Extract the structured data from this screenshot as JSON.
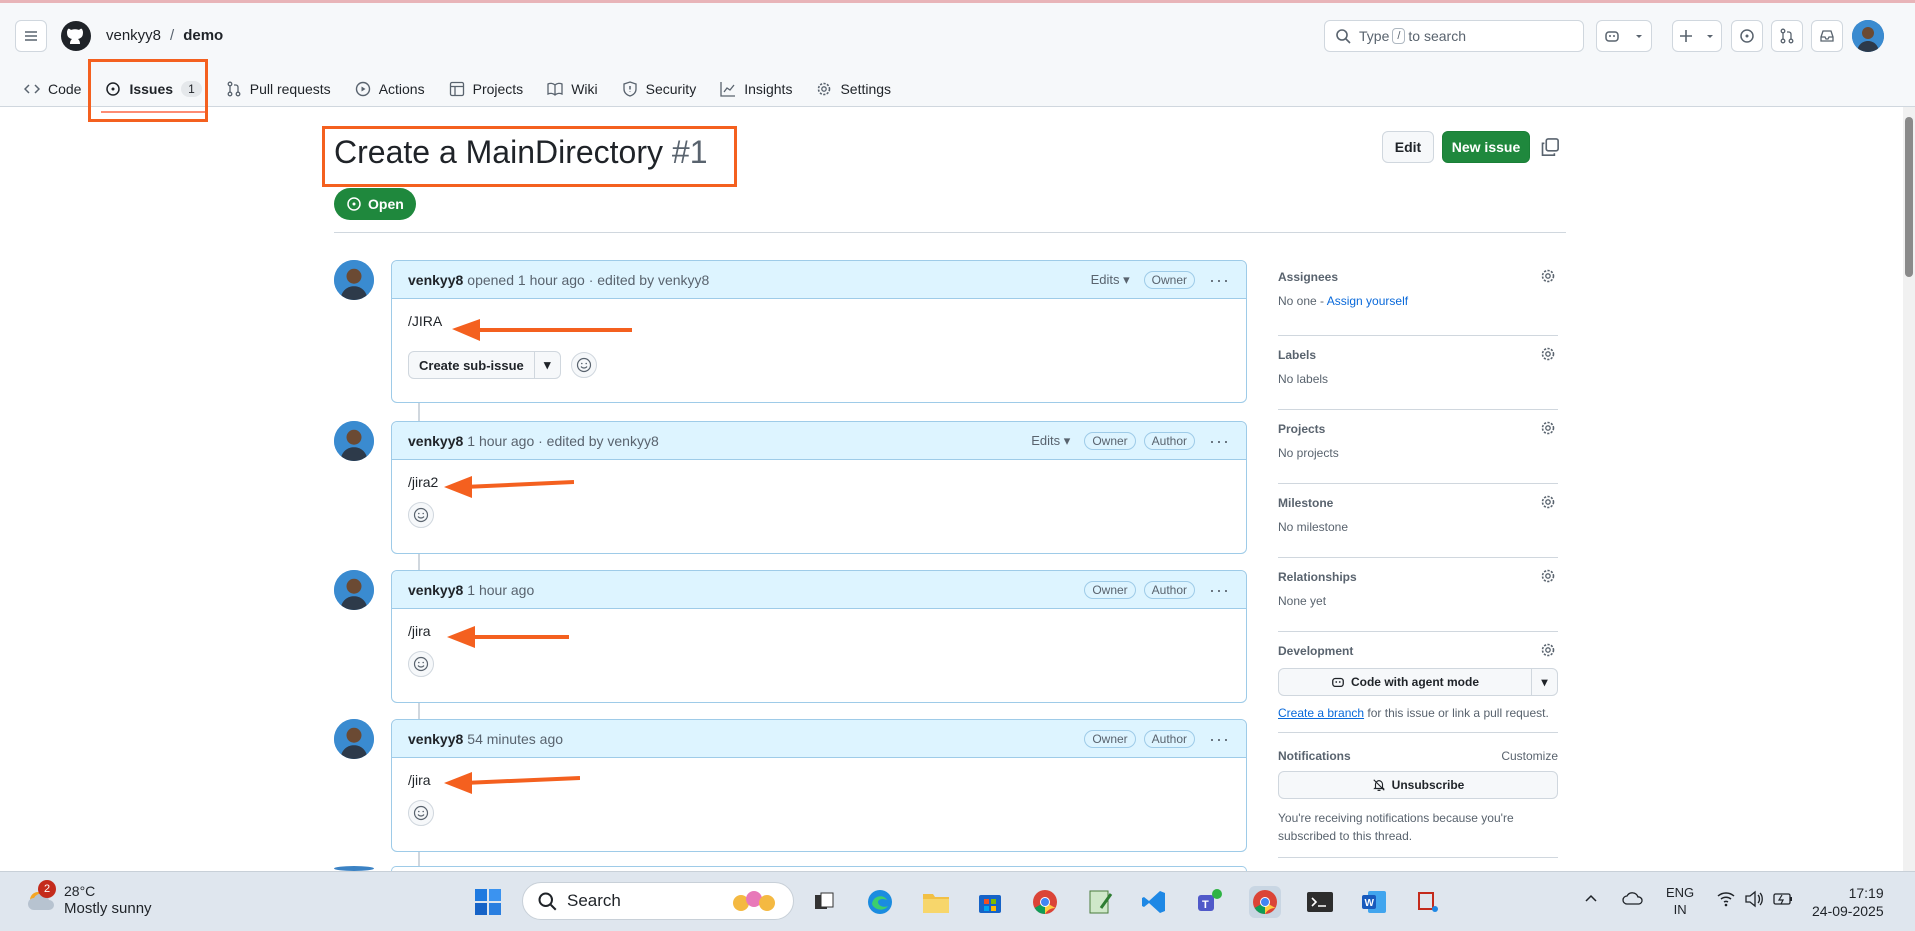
{
  "header": {
    "owner": "venkyy8",
    "separator": "/",
    "repo": "demo",
    "search_placeholder": "Type",
    "search_slash": "/",
    "search_suffix": "to search"
  },
  "tabs": [
    {
      "label": "Code",
      "icon": "code-icon"
    },
    {
      "label": "Issues",
      "icon": "issue-opened-icon",
      "count": "1",
      "active": true
    },
    {
      "label": "Pull requests",
      "icon": "git-pull-request-icon"
    },
    {
      "label": "Actions",
      "icon": "play-icon"
    },
    {
      "label": "Projects",
      "icon": "table-icon"
    },
    {
      "label": "Wiki",
      "icon": "book-icon"
    },
    {
      "label": "Security",
      "icon": "shield-icon"
    },
    {
      "label": "Insights",
      "icon": "graph-icon"
    },
    {
      "label": "Settings",
      "icon": "gear-icon"
    }
  ],
  "issue": {
    "title": "Create a MainDirectory",
    "number": "#1",
    "state": "Open",
    "edit_label": "Edit",
    "new_issue_label": "New issue"
  },
  "comments": [
    {
      "author": "venkyy8",
      "meta": "opened 1 hour ago · edited by venkyy8",
      "edits": "Edits",
      "roles": [
        "Owner"
      ],
      "body": "/JIRA",
      "sub_issue_label": "Create sub-issue"
    },
    {
      "author": "venkyy8",
      "meta": "1 hour ago · edited by venkyy8",
      "edits": "Edits",
      "roles": [
        "Owner",
        "Author"
      ],
      "body": "/jira2"
    },
    {
      "author": "venkyy8",
      "meta": "1 hour ago",
      "roles": [
        "Owner",
        "Author"
      ],
      "body": "/jira"
    },
    {
      "author": "venkyy8",
      "meta": "54 minutes ago",
      "roles": [
        "Owner",
        "Author"
      ],
      "body": "/jira"
    }
  ],
  "sidebar": {
    "assignees": {
      "title": "Assignees",
      "value": "No one - ",
      "link": "Assign yourself"
    },
    "labels": {
      "title": "Labels",
      "value": "No labels"
    },
    "projects": {
      "title": "Projects",
      "value": "No projects"
    },
    "milestone": {
      "title": "Milestone",
      "value": "No milestone"
    },
    "relationships": {
      "title": "Relationships",
      "value": "None yet"
    },
    "development": {
      "title": "Development",
      "agent_button": "Code with agent mode",
      "branch_link": "Create a branch",
      "branch_text": " for this issue or link a pull request."
    },
    "notifications": {
      "title": "Notifications",
      "customize": "Customize",
      "unsubscribe": "Unsubscribe",
      "text": "You're receiving notifications because you're subscribed to this thread."
    }
  },
  "taskbar": {
    "weather_badge": "2",
    "temperature": "28°C",
    "condition": "Mostly sunny",
    "search_label": "Search",
    "lang1": "ENG",
    "lang2": "IN",
    "time": "17:19",
    "date": "24-09-2025"
  },
  "colors": {
    "accent_green": "#1f883d",
    "highlight": "#f4601f",
    "comment_header": "#ddf4ff"
  }
}
